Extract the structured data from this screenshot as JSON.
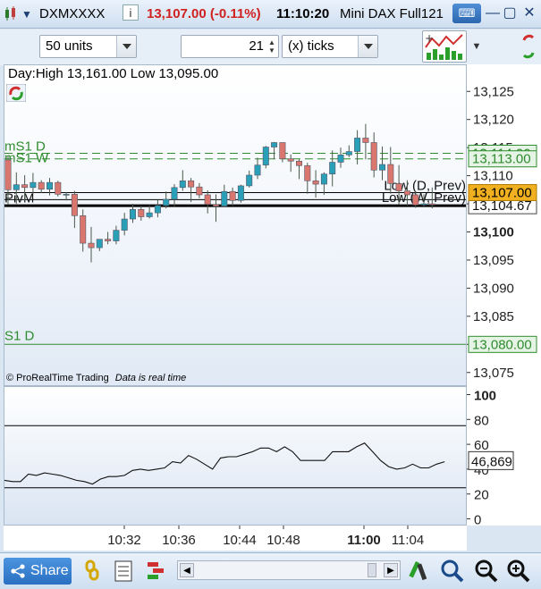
{
  "titlebar": {
    "instrument": "DXMXXXX",
    "price_change": "13,107.00 (-0.11%)",
    "time": "11:10:20",
    "name": "Mini DAX Full121"
  },
  "toolbar": {
    "units_value": "50 units",
    "ticks_value": "21",
    "ticks_unit": "(x) ticks"
  },
  "chart_info": {
    "day_range": "Day:High 13,161.00 Low 13,095.00",
    "copyright": "© ProRealTime Trading",
    "data_status": "Data is real time"
  },
  "bottombar": {
    "share_label": "Share"
  },
  "colors": {
    "bull": "#2aa0b8",
    "bear": "#d9776f",
    "level_green": "#2e8b2e",
    "current_price_bg": "#f0b020"
  },
  "chart_data": [
    {
      "type": "candlestick",
      "ylim": [
        13070,
        13130
      ],
      "y_ticks": [
        13075,
        13080,
        13085,
        13090,
        13095,
        13100,
        13105,
        13110,
        13115,
        13120,
        13125
      ],
      "y_tick_labels": [
        "13,075",
        "13,080",
        "13,085",
        "13,090",
        "13,095",
        "13,100",
        "13,105",
        "13,110",
        "13,115",
        "13,120",
        "13,125"
      ],
      "bold_tick_label": "13,100",
      "x_tick_labels": [
        "10:32",
        "10:36",
        "10:44",
        "10:48",
        "11:00",
        "11:04"
      ],
      "bold_x_tick_label": "11:00",
      "candles": [
        {
          "o": 13112.8,
          "h": 13113.5,
          "c": 13107.5,
          "l": 13104.8
        },
        {
          "o": 13107.5,
          "h": 13110.6,
          "c": 13108.4,
          "l": 13105.0
        },
        {
          "o": 13108.4,
          "h": 13110.1,
          "c": 13107.9,
          "l": 13105.6
        },
        {
          "o": 13107.9,
          "h": 13110.5,
          "c": 13108.8,
          "l": 13106.8
        },
        {
          "o": 13108.8,
          "h": 13109.2,
          "c": 13107.6,
          "l": 13106.9
        },
        {
          "o": 13107.6,
          "h": 13109.6,
          "c": 13108.8,
          "l": 13106.5
        },
        {
          "o": 13108.8,
          "h": 13109.1,
          "c": 13106.7,
          "l": 13106.3
        },
        {
          "o": 13106.7,
          "h": 13107.1,
          "c": 13106.7,
          "l": 13105.6
        },
        {
          "o": 13106.7,
          "h": 13107.3,
          "c": 13102.9,
          "l": 13100.7
        },
        {
          "o": 13102.9,
          "h": 13104.0,
          "c": 13098.0,
          "l": 13096.5
        },
        {
          "o": 13098.0,
          "h": 13100.9,
          "c": 13097.2,
          "l": 13094.6
        },
        {
          "o": 13097.2,
          "h": 13098.5,
          "c": 13098.7,
          "l": 13096.6
        },
        {
          "o": 13098.7,
          "h": 13100.0,
          "c": 13098.4,
          "l": 13097.8
        },
        {
          "o": 13098.4,
          "h": 13101.1,
          "c": 13100.3,
          "l": 13097.8
        },
        {
          "o": 13100.3,
          "h": 13103.4,
          "c": 13102.3,
          "l": 13099.4
        },
        {
          "o": 13102.3,
          "h": 13105.0,
          "c": 13104.0,
          "l": 13101.6
        },
        {
          "o": 13104.0,
          "h": 13104.7,
          "c": 13102.7,
          "l": 13102.0
        },
        {
          "o": 13102.7,
          "h": 13104.8,
          "c": 13103.4,
          "l": 13102.4
        },
        {
          "o": 13103.4,
          "h": 13105.7,
          "c": 13104.7,
          "l": 13102.6
        },
        {
          "o": 13104.7,
          "h": 13107.2,
          "c": 13105.8,
          "l": 13104.2
        },
        {
          "o": 13105.8,
          "h": 13108.5,
          "c": 13107.9,
          "l": 13104.5
        },
        {
          "o": 13107.9,
          "h": 13111.0,
          "c": 13109.1,
          "l": 13107.3
        },
        {
          "o": 13109.1,
          "h": 13109.6,
          "c": 13108.0,
          "l": 13105.3
        },
        {
          "o": 13108.0,
          "h": 13108.7,
          "c": 13106.6,
          "l": 13106.0
        },
        {
          "o": 13106.6,
          "h": 13107.4,
          "c": 13104.9,
          "l": 13103.3
        },
        {
          "o": 13104.9,
          "h": 13106.7,
          "c": 13104.6,
          "l": 13101.8
        },
        {
          "o": 13104.6,
          "h": 13108.4,
          "c": 13107.2,
          "l": 13104.4
        },
        {
          "o": 13107.2,
          "h": 13107.9,
          "c": 13105.6,
          "l": 13104.6
        },
        {
          "o": 13105.6,
          "h": 13108.4,
          "c": 13108.2,
          "l": 13105.2
        },
        {
          "o": 13108.2,
          "h": 13110.9,
          "c": 13110.1,
          "l": 13107.9
        },
        {
          "o": 13110.1,
          "h": 13113.2,
          "c": 13111.9,
          "l": 13109.4
        },
        {
          "o": 13111.9,
          "h": 13115.3,
          "c": 13115.1,
          "l": 13111.3
        },
        {
          "o": 13115.1,
          "h": 13116.0,
          "c": 13115.9,
          "l": 13113.0
        },
        {
          "o": 13115.9,
          "h": 13114.9,
          "c": 13113.0,
          "l": 13112.4
        },
        {
          "o": 13113.0,
          "h": 13113.8,
          "c": 13112.6,
          "l": 13110.7
        },
        {
          "o": 13112.6,
          "h": 13112.9,
          "c": 13111.8,
          "l": 13109.4
        },
        {
          "o": 13111.8,
          "h": 13112.3,
          "c": 13109.1,
          "l": 13106.8
        },
        {
          "o": 13109.1,
          "h": 13111.0,
          "c": 13108.5,
          "l": 13106.1
        },
        {
          "o": 13108.5,
          "h": 13110.6,
          "c": 13110.3,
          "l": 13106.6
        },
        {
          "o": 13110.3,
          "h": 13114.5,
          "c": 13112.4,
          "l": 13108.1
        },
        {
          "o": 13112.4,
          "h": 13115.0,
          "c": 13113.7,
          "l": 13111.4
        },
        {
          "o": 13113.7,
          "h": 13115.4,
          "c": 13114.3,
          "l": 13113.3
        },
        {
          "o": 13114.3,
          "h": 13118.1,
          "c": 13116.7,
          "l": 13112.0
        },
        {
          "o": 13116.7,
          "h": 13119.2,
          "c": 13115.9,
          "l": 13112.9
        },
        {
          "o": 13115.9,
          "h": 13117.7,
          "c": 13111.0,
          "l": 13109.7
        },
        {
          "o": 13111.0,
          "h": 13115.2,
          "c": 13112.0,
          "l": 13109.2
        },
        {
          "o": 13112.0,
          "h": 13115.1,
          "c": 13108.6,
          "l": 13106.8
        },
        {
          "o": 13108.6,
          "h": 13111.9,
          "c": 13107.3,
          "l": 13104.9
        },
        {
          "o": 13107.3,
          "h": 13109.2,
          "c": 13106.6,
          "l": 13104.7
        },
        {
          "o": 13106.6,
          "h": 13107.2,
          "c": 13104.8,
          "l": 13104.3
        },
        {
          "o": 13104.8,
          "h": 13106.7,
          "c": 13105.0,
          "l": 13104.4
        },
        {
          "o": 13105.0,
          "h": 13107.9,
          "c": 13104.8,
          "l": 13104.2
        }
      ],
      "levels": [
        {
          "label": "mS1 D",
          "value": 13114.0,
          "price_label": "13,114.00",
          "style": "dashed",
          "color": "#2e8b2e"
        },
        {
          "label": "mS1 W",
          "value": 13113.0,
          "price_label": "13,113.00",
          "style": "dashed",
          "color": "#2e8b2e"
        },
        {
          "label": "Low (D, Prev)",
          "value": 13107.0,
          "price_label": "",
          "style": "thin",
          "color": "#000000"
        },
        {
          "label": "PivM",
          "value": 13105.75,
          "price_label": "13,105.75",
          "style": "thin",
          "color": "#000000"
        },
        {
          "label": "Low (W, Prev)",
          "value": 13104.67,
          "price_label": "13,104.67",
          "style": "thick",
          "color": "#000000"
        },
        {
          "label": "S1 D",
          "value": 13080.0,
          "price_label": "13,080.00",
          "style": "solid",
          "color": "#2e8b2e"
        }
      ],
      "current_price": {
        "value": 13107.0,
        "label": "13,107.00"
      }
    },
    {
      "type": "line",
      "ylim": [
        -5,
        105
      ],
      "y_ticks": [
        0,
        20,
        40,
        60,
        80,
        100
      ],
      "y_tick_labels": [
        "0",
        "20",
        "40",
        "60",
        "80",
        "100"
      ],
      "bold_tick_label": "100",
      "ref_lines": [
        75,
        25
      ],
      "current": {
        "value": 46.869,
        "label": "46,869"
      },
      "values": [
        31,
        30,
        30,
        36,
        35,
        37,
        36,
        35,
        33,
        31,
        30,
        28,
        32,
        34,
        34,
        35,
        39,
        40,
        39,
        40,
        41,
        46,
        45,
        51,
        48,
        44,
        40,
        49,
        50,
        50,
        52,
        54,
        57,
        57,
        54,
        58,
        54,
        47,
        47,
        47,
        47,
        54,
        54,
        54,
        58,
        61,
        54,
        47,
        42,
        40,
        41,
        44,
        41,
        41,
        44,
        46
      ]
    }
  ]
}
